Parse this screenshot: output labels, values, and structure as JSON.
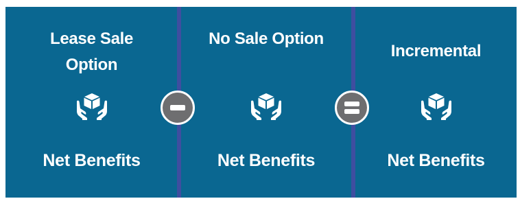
{
  "colors": {
    "panel": "#0a6791",
    "divider": "#3f4ea0",
    "operator": "#6e6e70",
    "text": "#ffffff"
  },
  "panels": [
    {
      "title": "Lease Sale Option",
      "icon": "box-in-hands-icon",
      "footer": "Net Benefits"
    },
    {
      "title": "No Sale Option",
      "icon": "box-in-hands-icon",
      "footer": "Net Benefits"
    },
    {
      "title": "Incremental",
      "icon": "box-in-hands-icon",
      "footer": "Net Benefits"
    }
  ],
  "operators": [
    {
      "icon": "minus-icon"
    },
    {
      "icon": "equals-icon"
    }
  ]
}
